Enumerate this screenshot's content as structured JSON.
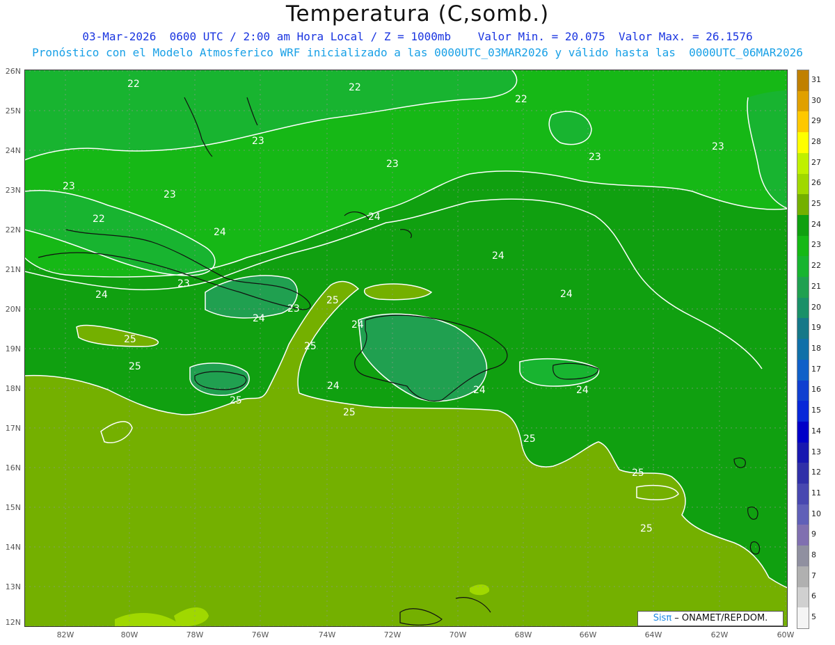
{
  "header": {
    "title": "Temperatura (C,somb.)",
    "line1": "03-Mar-2026  0600 UTC / 2:00 am Hora Local / Z = 1000mb    Valor Min. = 20.075  Valor Max. = 26.1576",
    "line2": "Pronóstico con el Modelo Atmosferico WRF inicializado a las 0000UTC_03MAR2026 y válido hasta las  0000UTC_06MAR2026"
  },
  "axes": {
    "lat_labels": [
      "26N",
      "25N",
      "24N",
      "23N",
      "22N",
      "21N",
      "20N",
      "19N",
      "18N",
      "17N",
      "16N",
      "15N",
      "14N",
      "13N",
      "12N"
    ],
    "lon_labels": [
      "82W",
      "80W",
      "78W",
      "76W",
      "74W",
      "72W",
      "70W",
      "68W",
      "66W",
      "64W",
      "62W",
      "60W"
    ]
  },
  "colorbar": {
    "labels": [
      "31",
      "30",
      "29",
      "28",
      "27",
      "26",
      "25",
      "24",
      "23",
      "22",
      "21",
      "20",
      "19",
      "18",
      "17",
      "16",
      "15",
      "14",
      "13",
      "12",
      "11",
      "10",
      "9",
      "8",
      "7",
      "6",
      "5"
    ],
    "colors": [
      "#c08000",
      "#e0a000",
      "#ffc800",
      "#ffff00",
      "#c0f000",
      "#a0d800",
      "#74b000",
      "#10a010",
      "#16b816",
      "#18b430",
      "#20a050",
      "#1a9068",
      "#167888",
      "#1070a8",
      "#1060c8",
      "#1040d0",
      "#0828d8",
      "#0000c8",
      "#1818b0",
      "#3030a8",
      "#4848b0",
      "#6060b8",
      "#8070b0",
      "#9090a0",
      "#b0b0b0",
      "#d0d0d0",
      "#f4f4f4"
    ]
  },
  "contour_labels": [
    "22",
    "22",
    "22",
    "22",
    "23",
    "23",
    "23",
    "23",
    "23",
    "23",
    "23",
    "23",
    "24",
    "24",
    "24",
    "24",
    "24",
    "24",
    "24",
    "24",
    "24",
    "24",
    "25",
    "25",
    "25",
    "25",
    "25",
    "25",
    "25",
    "25",
    "25"
  ],
  "credit": {
    "logo": "Sisπ",
    "text": " – ONAMET/REP.DOM."
  }
}
